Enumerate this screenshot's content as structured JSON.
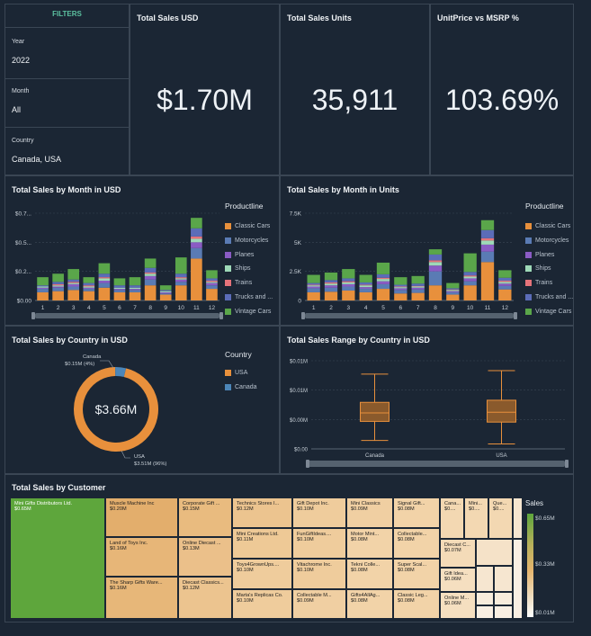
{
  "filters": {
    "title": "FILTERS",
    "year_label": "Year",
    "year_value": "2022",
    "month_label": "Month",
    "month_value": "All",
    "country_label": "Country",
    "country_value": "Canada, USA"
  },
  "kpis": [
    {
      "title": "Total Sales USD",
      "value": "$1.70M"
    },
    {
      "title": "Total Sales Units",
      "value": "35,911"
    },
    {
      "title": "UnitPrice vs MSRP %",
      "value": "103.69%"
    }
  ],
  "colors": {
    "classic_cars": "#e8903c",
    "motorcycles": "#5a7bb4",
    "planes": "#8a5cc4",
    "ships": "#9ed9b8",
    "trains": "#e5737a",
    "trucks": "#5b6cb8",
    "vintage": "#5aa64a",
    "usa": "#e8903c",
    "canada": "#4c86b8"
  },
  "legend": {
    "title": "Productline",
    "items": [
      "Classic Cars",
      "Motorcycles",
      "Planes",
      "Ships",
      "Trains",
      "Trucks and ...",
      "Vintage Cars"
    ]
  },
  "country_legend": {
    "title": "Country",
    "items": [
      "USA",
      "Canada"
    ]
  },
  "treemap": {
    "title": "Total Sales by Customer",
    "legend_title": "Sales",
    "legend_ticks": [
      "$0.65M",
      "$0.33M",
      "$0.01M"
    ],
    "items": [
      {
        "name": "Mini Gifts Distributors Ltd.",
        "value": "$0.65M"
      },
      {
        "name": "Muscle Machine Inc",
        "value": "$0.20M"
      },
      {
        "name": "Land of Toys Inc.",
        "value": "$0.16M"
      },
      {
        "name": "The Sharp Gifts Ware...",
        "value": "$0.16M"
      },
      {
        "name": "Corporate Gift ...",
        "value": "$0.15M"
      },
      {
        "name": "Online Diecast ...",
        "value": "$0.13M"
      },
      {
        "name": "Diecast Classics...",
        "value": "$0.12M"
      },
      {
        "name": "Technics Stores I...",
        "value": "$0.12M"
      },
      {
        "name": "Mini Creations Ltd.",
        "value": "$0.11M"
      },
      {
        "name": "Toys4GrownUps....",
        "value": "$0.10M"
      },
      {
        "name": "Marta's Replicas Co.",
        "value": "$0.10M"
      },
      {
        "name": "Gift Depot Inc.",
        "value": "$0.10M"
      },
      {
        "name": "FunGiftIdeas....",
        "value": "$0.10M"
      },
      {
        "name": "Vitachrome Inc.",
        "value": "$0.10M"
      },
      {
        "name": "Collectable M...",
        "value": "$0.09M"
      },
      {
        "name": "Mini Classics",
        "value": "$0.09M"
      },
      {
        "name": "Motor Mint...",
        "value": "$0.08M"
      },
      {
        "name": "Tekni Colle...",
        "value": "$0.08M"
      },
      {
        "name": "Gifts4AllAg...",
        "value": "$0.08M"
      },
      {
        "name": "Signal Gift...",
        "value": "$0.08M"
      },
      {
        "name": "Collectable...",
        "value": "$0.08M"
      },
      {
        "name": "Super Scal...",
        "value": "$0.08M"
      },
      {
        "name": "Classic Leg...",
        "value": "$0.08M"
      },
      {
        "name": "Cana...",
        "value": "$0...."
      },
      {
        "name": "Mini...",
        "value": "$0...."
      },
      {
        "name": "Que...",
        "value": "$0...."
      },
      {
        "name": "Diecast C...",
        "value": "$0.07M"
      },
      {
        "name": "Gift Idea...",
        "value": "$0.06M"
      },
      {
        "name": "Online M...",
        "value": "$0.06M"
      }
    ]
  },
  "chart_data": [
    {
      "type": "bar",
      "stacked": true,
      "title": "Total Sales by Month in USD",
      "categories": [
        "1",
        "2",
        "3",
        "4",
        "5",
        "6",
        "7",
        "8",
        "9",
        "10",
        "11",
        "12"
      ],
      "yticks": [
        "$0.00",
        "$0.2...",
        "$0.5...",
        "$0.7..."
      ],
      "ylim": [
        0,
        0.75
      ],
      "series": [
        {
          "name": "Classic Cars",
          "values": [
            0.07,
            0.08,
            0.09,
            0.08,
            0.11,
            0.07,
            0.07,
            0.13,
            0.05,
            0.13,
            0.36,
            0.1
          ]
        },
        {
          "name": "Motorcycles",
          "values": [
            0.03,
            0.03,
            0.03,
            0.02,
            0.04,
            0.02,
            0.02,
            0.05,
            0.01,
            0.03,
            0.09,
            0.03
          ]
        },
        {
          "name": "Planes",
          "values": [
            0.01,
            0.01,
            0.02,
            0.01,
            0.02,
            0.01,
            0.01,
            0.03,
            0.01,
            0.02,
            0.05,
            0.02
          ]
        },
        {
          "name": "Ships",
          "values": [
            0.01,
            0.01,
            0.01,
            0.01,
            0.02,
            0.01,
            0.01,
            0.02,
            0.01,
            0.01,
            0.03,
            0.01
          ]
        },
        {
          "name": "Trains",
          "values": [
            0.0,
            0.01,
            0.01,
            0.01,
            0.01,
            0.0,
            0.0,
            0.01,
            0.0,
            0.01,
            0.02,
            0.01
          ]
        },
        {
          "name": "Trucks and ...",
          "values": [
            0.01,
            0.02,
            0.02,
            0.02,
            0.03,
            0.02,
            0.02,
            0.04,
            0.01,
            0.03,
            0.07,
            0.02
          ]
        },
        {
          "name": "Vintage Cars",
          "values": [
            0.07,
            0.07,
            0.09,
            0.05,
            0.09,
            0.06,
            0.07,
            0.08,
            0.04,
            0.14,
            0.09,
            0.07
          ]
        }
      ]
    },
    {
      "type": "bar",
      "stacked": true,
      "title": "Total Sales by Month in Units",
      "categories": [
        "1",
        "2",
        "3",
        "4",
        "5",
        "6",
        "7",
        "8",
        "9",
        "10",
        "11",
        "12"
      ],
      "yticks": [
        "0",
        "2.5K",
        "5K",
        "7.5K"
      ],
      "ylim": [
        0,
        7500
      ],
      "series": [
        {
          "name": "Classic Cars",
          "values": [
            700,
            750,
            850,
            700,
            1000,
            600,
            650,
            1300,
            500,
            1300,
            3300,
            950
          ]
        },
        {
          "name": "Motorcycles",
          "values": [
            350,
            350,
            350,
            300,
            400,
            300,
            300,
            1200,
            200,
            350,
            900,
            300
          ]
        },
        {
          "name": "Planes",
          "values": [
            150,
            200,
            200,
            150,
            250,
            150,
            150,
            500,
            100,
            250,
            600,
            200
          ]
        },
        {
          "name": "Ships",
          "values": [
            100,
            150,
            150,
            150,
            200,
            100,
            100,
            300,
            100,
            150,
            350,
            150
          ]
        },
        {
          "name": "Trains",
          "values": [
            50,
            100,
            100,
            50,
            100,
            50,
            50,
            150,
            50,
            100,
            200,
            100
          ]
        },
        {
          "name": "Trucks and ...",
          "values": [
            150,
            200,
            250,
            200,
            300,
            150,
            200,
            500,
            100,
            300,
            700,
            250
          ]
        },
        {
          "name": "Vintage Cars",
          "values": [
            700,
            650,
            800,
            650,
            1000,
            650,
            650,
            450,
            450,
            1600,
            850,
            650
          ]
        }
      ]
    },
    {
      "type": "pie",
      "donut": true,
      "title": "Total Sales by Country in USD",
      "center_label": "$3.66M",
      "slices": [
        {
          "name": "USA",
          "value": 3.51,
          "percent": 96,
          "label": "USA",
          "sublabel": "$3.51M (96%)"
        },
        {
          "name": "Canada",
          "value": 0.15,
          "percent": 4,
          "label": "Canada",
          "sublabel": "$0.15M (4%)"
        }
      ]
    },
    {
      "type": "box",
      "title": "Total Sales Range by Country in USD",
      "categories": [
        "Canada",
        "USA"
      ],
      "yticks": [
        "$0.00",
        "$0.00M",
        "$0.01M",
        "$0.01M"
      ],
      "ylim": [
        0,
        0.0125
      ],
      "boxes": [
        {
          "name": "Canada",
          "min": 0.0012,
          "q1": 0.0039,
          "median": 0.0051,
          "q3": 0.0066,
          "max": 0.0106
        },
        {
          "name": "USA",
          "min": 0.0007,
          "q1": 0.0038,
          "median": 0.0052,
          "q3": 0.0069,
          "max": 0.0111
        }
      ]
    }
  ]
}
